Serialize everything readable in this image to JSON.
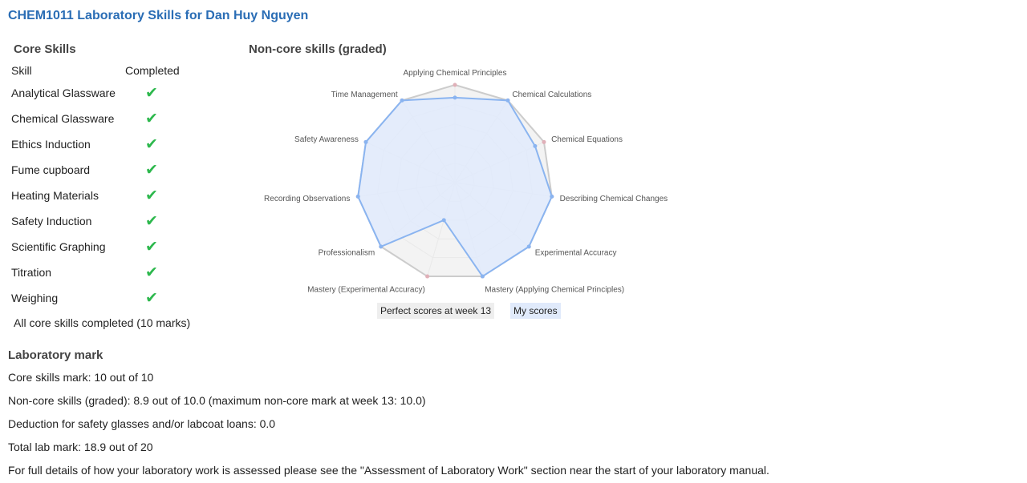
{
  "page": {
    "title": "CHEM1011 Laboratory Skills for Dan Huy Nguyen"
  },
  "core": {
    "title": "Core Skills",
    "col_skill": "Skill",
    "col_completed": "Completed",
    "rows": [
      {
        "skill": "Analytical Glassware",
        "completed": "✔"
      },
      {
        "skill": "Chemical Glassware",
        "completed": "✔"
      },
      {
        "skill": "Ethics Induction",
        "completed": "✔"
      },
      {
        "skill": "Fume cupboard",
        "completed": "✔"
      },
      {
        "skill": "Heating Materials",
        "completed": "✔"
      },
      {
        "skill": "Safety Induction",
        "completed": "✔"
      },
      {
        "skill": "Scientific Graphing",
        "completed": "✔"
      },
      {
        "skill": "Titration",
        "completed": "✔"
      },
      {
        "skill": "Weighing",
        "completed": "✔"
      }
    ],
    "summary": "All core skills completed (10 marks)"
  },
  "noncore": {
    "title": "Non-core skills (graded)"
  },
  "chart_data": {
    "type": "radar",
    "title": "",
    "categories": [
      "Applying Chemical Principles",
      "Chemical Calculations",
      "Chemical Equations",
      "Describing Chemical Changes",
      "Experimental Accuracy",
      "Mastery (Applying Chemical Principles)",
      "Mastery (Experimental Accuracy)",
      "Professionalism",
      "Recording Observations",
      "Safety Awareness",
      "Time Management"
    ],
    "rmax": 1.0,
    "grid_levels": 5,
    "series": [
      {
        "name": "Perfect scores at week 13",
        "values": [
          1,
          1,
          1,
          1,
          1,
          1,
          1,
          1,
          1,
          1,
          1
        ],
        "color": "#cccccc",
        "fill": "#eeeeee"
      },
      {
        "name": "My scores",
        "values": [
          0.87,
          1.0,
          0.9,
          1.0,
          1.0,
          1.0,
          0.4,
          1.0,
          1.0,
          1.0,
          1.0
        ],
        "color": "#8ab4f0",
        "fill": "#e0eafb"
      }
    ]
  },
  "lab": {
    "title": "Laboratory mark",
    "core_mark": "Core skills mark: 10 out of 10",
    "noncore_mark": "Non-core skills (graded): 8.9 out of 10.0 (maximum non-core mark at week 13: 10.0)",
    "deduction": "Deduction for safety glasses and/or labcoat loans: 0.0",
    "total": "Total lab mark: 18.9 out of 20",
    "details": "For full details of how your laboratory work is assessed please see the \"Assessment of Laboratory Work\" section near the start of your laboratory manual."
  }
}
